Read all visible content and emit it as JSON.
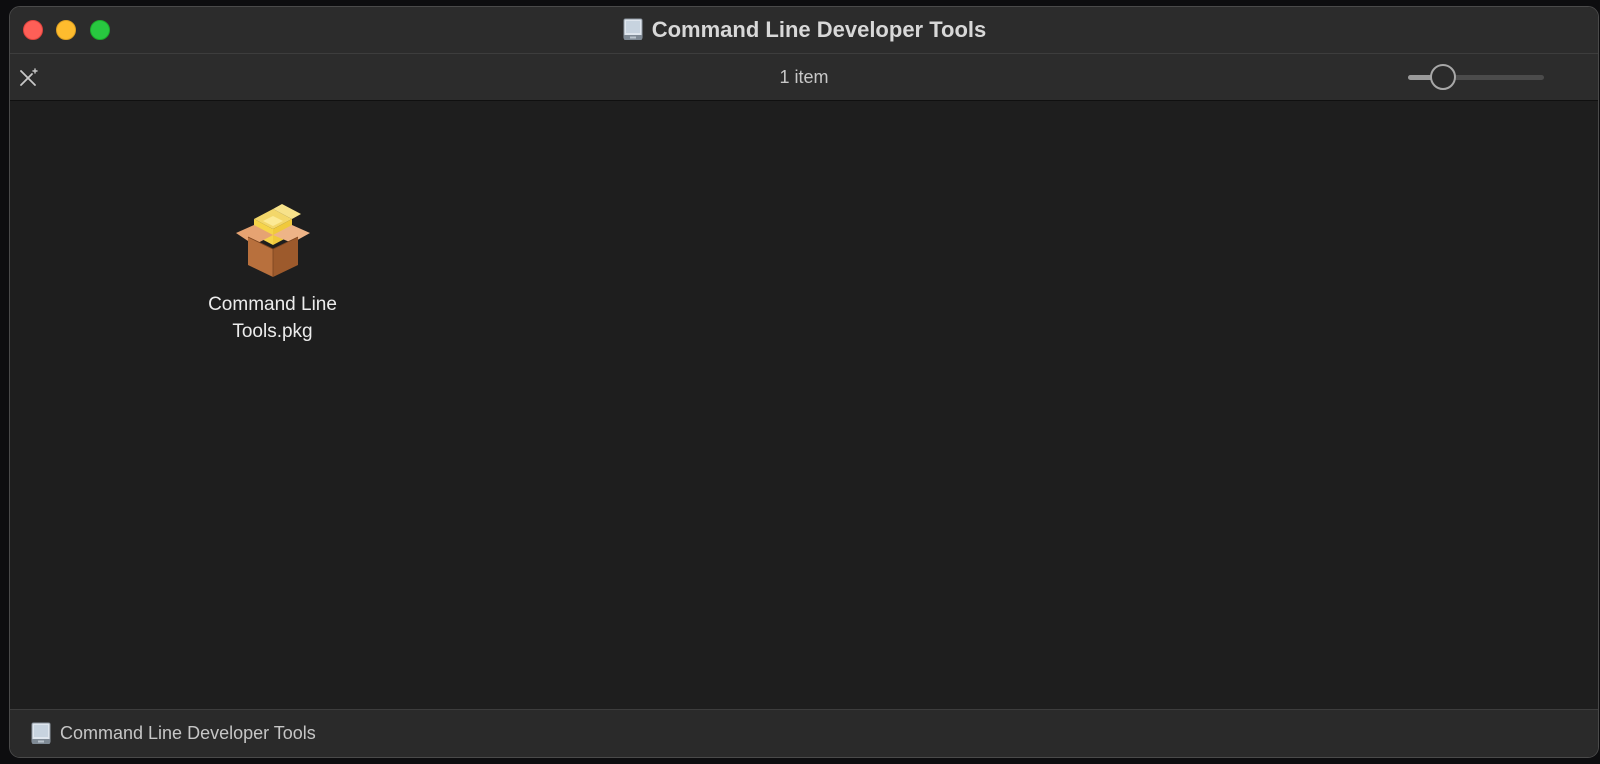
{
  "window": {
    "title": "Command Line Developer Tools",
    "title_icon": "disk-image-icon"
  },
  "toolbar": {
    "item_count": "1 item",
    "tool_icon": "wand-icon",
    "icon_size_slider": {
      "value": 0.2
    }
  },
  "files": [
    {
      "name": "Command Line Tools.pkg",
      "icon": "package-icon"
    }
  ],
  "pathbar": {
    "label": "Command Line Developer Tools",
    "icon": "disk-image-icon"
  },
  "colors": {
    "close": "#fe5f57",
    "minimize": "#febc2e",
    "maximize": "#28c840",
    "background": "#1e1e1e",
    "chrome": "#2c2c2c"
  }
}
